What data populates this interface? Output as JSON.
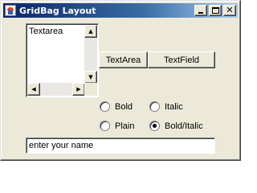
{
  "window": {
    "title": "GridBag Layout",
    "close_glyph": "✕"
  },
  "textarea": {
    "content": "Textarea",
    "scroll_up": "▲",
    "scroll_down": "▼",
    "scroll_left": "◀",
    "scroll_right": "▶"
  },
  "buttons": {
    "textarea_label": "TextArea",
    "textfield_label": "TextField"
  },
  "radios": [
    {
      "label": "Bold",
      "checked": false
    },
    {
      "label": "Italic",
      "checked": false
    },
    {
      "label": "Plain",
      "checked": false
    },
    {
      "label": "Bold/Italic",
      "checked": true
    }
  ],
  "name_field": {
    "value": "enter your name"
  },
  "colors": {
    "titlebar_start": "#0a246a",
    "titlebar_end": "#a6caf0",
    "face": "#ece9d8"
  }
}
